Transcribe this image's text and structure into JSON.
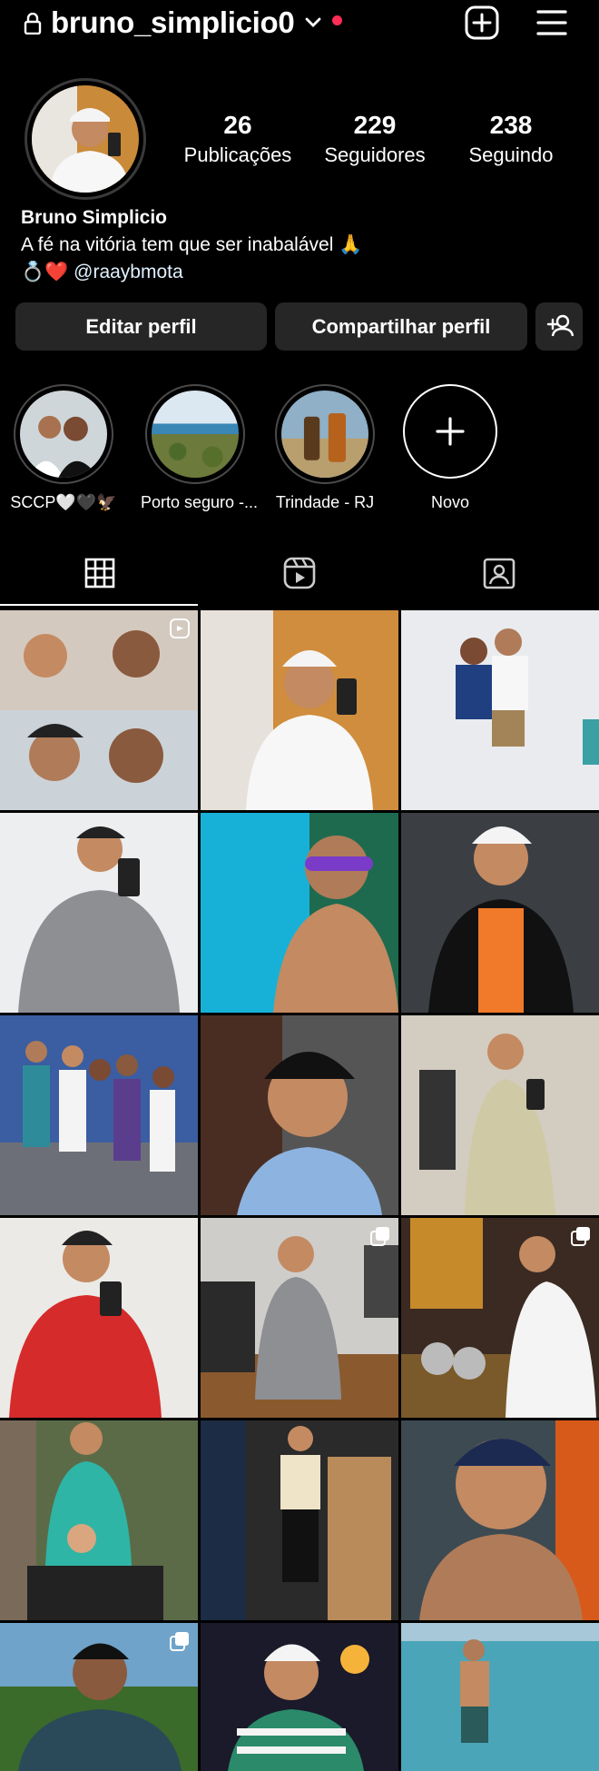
{
  "header": {
    "username": "bruno_simplicio0",
    "icons": [
      "lock-icon",
      "chevron-down-icon",
      "new-post-icon",
      "menu-icon"
    ],
    "notification_color": "#ff2d55"
  },
  "stats": {
    "posts": {
      "value": "26",
      "label": "Publicações"
    },
    "followers": {
      "value": "229",
      "label": "Seguidores"
    },
    "following": {
      "value": "238",
      "label": "Seguindo"
    }
  },
  "bio": {
    "name": "Bruno Simplicio",
    "line1": "A fé na vitória tem que ser inabalável 🙏",
    "line2_prefix": "💍❤️",
    "mention": "@raaybmota"
  },
  "actions": {
    "edit": "Editar perfil",
    "share": "Compartilhar perfil"
  },
  "highlights": [
    {
      "label": "SCCP🤍🖤🦅"
    },
    {
      "label": "Porto seguro -..."
    },
    {
      "label": "Trindade - RJ"
    },
    {
      "label": "Novo"
    }
  ],
  "tabs": [
    "grid-icon",
    "reels-icon",
    "tagged-icon"
  ],
  "colors": {
    "background": "#000000",
    "button": "#262626",
    "text": "#ffffff"
  }
}
